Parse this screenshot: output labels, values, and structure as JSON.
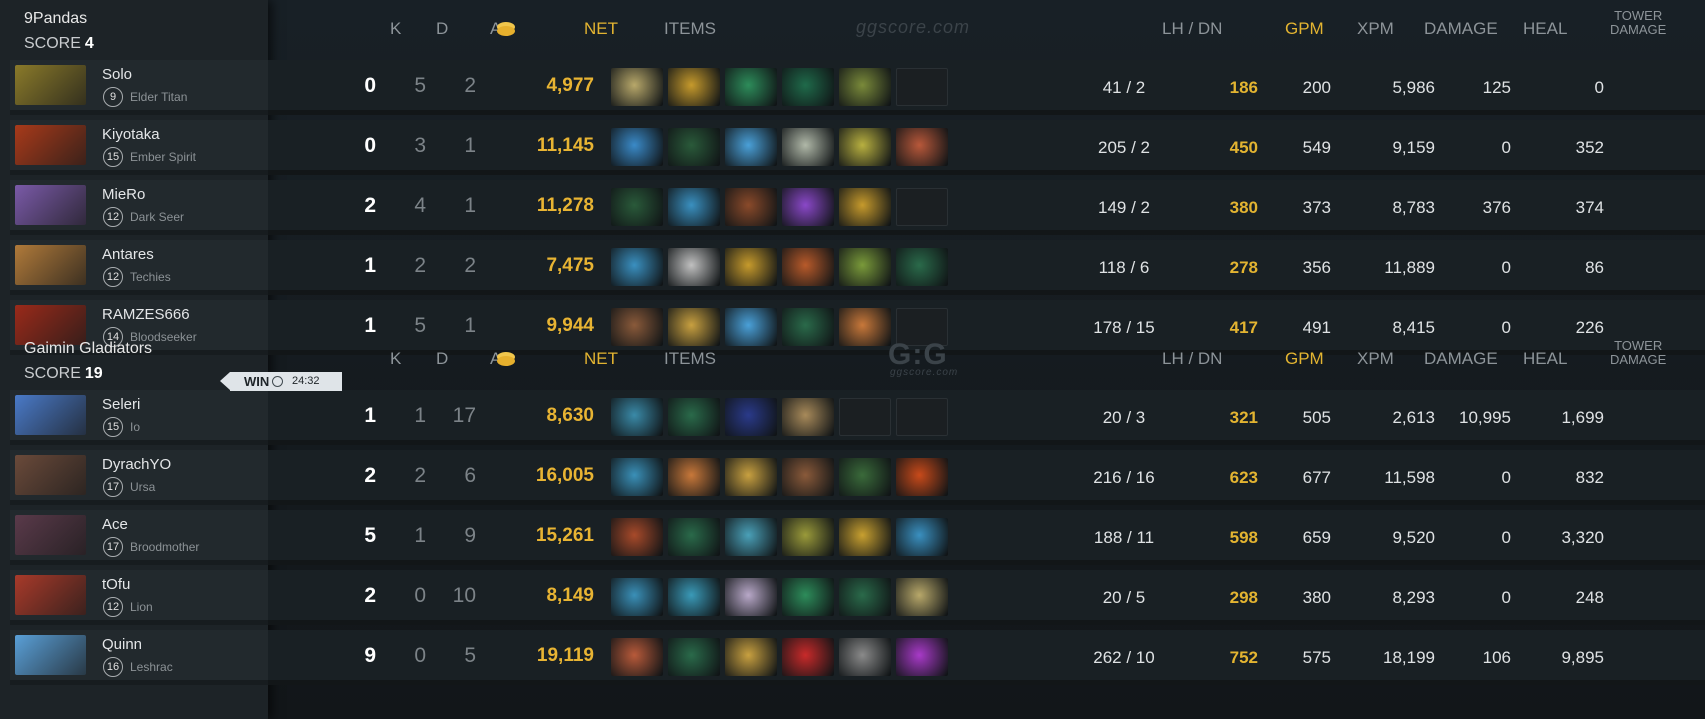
{
  "headers": {
    "k": "K",
    "d": "D",
    "a": "A",
    "net": "NET",
    "items": "ITEMS",
    "lh_dn": "LH  /  DN",
    "gpm": "GPM",
    "xpm": "XPM",
    "damage": "DAMAGE",
    "heal": "HEAL",
    "tower_line1": "TOWER",
    "tower_line2": "DAMAGE"
  },
  "watermarks": {
    "top": "ggscore.com",
    "logo": "G:G",
    "logo_sub": "ggscore.com"
  },
  "match": {
    "result": "WIN",
    "duration": "24:32"
  },
  "teams": [
    {
      "name": "9Pandas",
      "score_label": "SCORE",
      "score": "4",
      "players": [
        {
          "name": "Solo",
          "level": "9",
          "hero": "Elder Titan",
          "k": "0",
          "d": "5",
          "a": "2",
          "net": "4,977",
          "lh_dn": "41  /  2",
          "gpm": "186",
          "xpm": "200",
          "damage": "5,986",
          "heal": "125",
          "tower": "0",
          "portrait": "#8a7a2a",
          "items": [
            "#b8a86a",
            "#c69a2c",
            "#2d8c5a",
            "#1f6a4a",
            "#7a8a3a",
            "empty"
          ]
        },
        {
          "name": "Kiyotaka",
          "level": "15",
          "hero": "Ember Spirit",
          "k": "0",
          "d": "3",
          "a": "1",
          "net": "11,145",
          "lh_dn": "205  /  2",
          "gpm": "450",
          "xpm": "549",
          "damage": "9,159",
          "heal": "0",
          "tower": "352",
          "portrait": "#a83a1a",
          "items": [
            "#3a8ac8",
            "#2a5a3a",
            "#4aa0d8",
            "#b0b8a8",
            "#b8b040",
            "#b8583a"
          ]
        },
        {
          "name": "MieRo",
          "level": "12",
          "hero": "Dark Seer",
          "k": "2",
          "d": "4",
          "a": "1",
          "net": "11,278",
          "lh_dn": "149  /  2",
          "gpm": "380",
          "xpm": "373",
          "damage": "8,783",
          "heal": "376",
          "tower": "374",
          "portrait": "#7a5aa8",
          "items": [
            "#2a5a3a",
            "#3a90c0",
            "#8a4a2a",
            "#8a48c8",
            "#c69a2c",
            "empty"
          ]
        },
        {
          "name": "Antares",
          "level": "12",
          "hero": "Techies",
          "k": "1",
          "d": "2",
          "a": "2",
          "net": "7,475",
          "lh_dn": "118  /  6",
          "gpm": "278",
          "xpm": "356",
          "damage": "11,889",
          "heal": "0",
          "tower": "86",
          "portrait": "#b07a3a",
          "items": [
            "#3a90c0",
            "#c0c0c0",
            "#c69a2c",
            "#b85a2a",
            "#7a9a3a",
            "#2a6a4a"
          ]
        },
        {
          "name": "RAMZES666",
          "level": "14",
          "hero": "Bloodseeker",
          "k": "1",
          "d": "5",
          "a": "1",
          "net": "9,944",
          "lh_dn": "178  /  15",
          "gpm": "417",
          "xpm": "491",
          "damage": "8,415",
          "heal": "0",
          "tower": "226",
          "portrait": "#9a2a1a",
          "items": [
            "#8a5a3a",
            "#c8a040",
            "#4aa0d8",
            "#2a6a4a",
            "#c8783a",
            "empty"
          ]
        }
      ]
    },
    {
      "name": "Gaimin Gladiators",
      "score_label": "SCORE",
      "score": "19",
      "players": [
        {
          "name": "Seleri",
          "level": "15",
          "hero": "Io",
          "k": "1",
          "d": "1",
          "a": "17",
          "net": "8,630",
          "lh_dn": "20  /  3",
          "gpm": "321",
          "xpm": "505",
          "damage": "2,613",
          "heal": "10,995",
          "tower": "1,699",
          "portrait": "#4a7ac8",
          "items": [
            "#3a8aa8",
            "#2a6a4a",
            "#2a3a8a",
            "#a88a5a",
            "empty",
            "empty"
          ]
        },
        {
          "name": "DyrachYO",
          "level": "17",
          "hero": "Ursa",
          "k": "2",
          "d": "2",
          "a": "6",
          "net": "16,005",
          "lh_dn": "216  /  16",
          "gpm": "623",
          "xpm": "677",
          "damage": "11,598",
          "heal": "0",
          "tower": "832",
          "portrait": "#6a4a3a",
          "items": [
            "#3a90b8",
            "#c8783a",
            "#c8a040",
            "#8a5a3a",
            "#3a6a3a",
            "#c84a1a"
          ]
        },
        {
          "name": "Ace",
          "level": "17",
          "hero": "Broodmother",
          "k": "5",
          "d": "1",
          "a": "9",
          "net": "15,261",
          "lh_dn": "188  /  11",
          "gpm": "598",
          "xpm": "659",
          "damage": "9,520",
          "heal": "0",
          "tower": "3,320",
          "portrait": "#5a3a4a",
          "items": [
            "#a84a2a",
            "#2a6a4a",
            "#4aa0b8",
            "#9a9a3a",
            "#c8a030",
            "#3a90c0"
          ]
        },
        {
          "name": "tOfu",
          "level": "12",
          "hero": "Lion",
          "k": "2",
          "d": "0",
          "a": "10",
          "net": "8,149",
          "lh_dn": "20  /  5",
          "gpm": "298",
          "xpm": "380",
          "damage": "8,293",
          "heal": "0",
          "tower": "248",
          "portrait": "#a83a2a",
          "items": [
            "#3a90b8",
            "#3a9ab8",
            "#b8a8c8",
            "#2d8c5a",
            "#2a6a4a",
            "#b8a86a"
          ]
        },
        {
          "name": "Quinn",
          "level": "16",
          "hero": "Leshrac",
          "k": "9",
          "d": "0",
          "a": "5",
          "net": "19,119",
          "lh_dn": "262  /  10",
          "gpm": "752",
          "xpm": "575",
          "damage": "18,199",
          "heal": "106",
          "tower": "9,895",
          "portrait": "#5aa0d8",
          "items": [
            "#b85a3a",
            "#2a6a4a",
            "#c8a040",
            "#c82a2a",
            "#8a8a8a",
            "#a83ac8"
          ]
        }
      ]
    }
  ]
}
